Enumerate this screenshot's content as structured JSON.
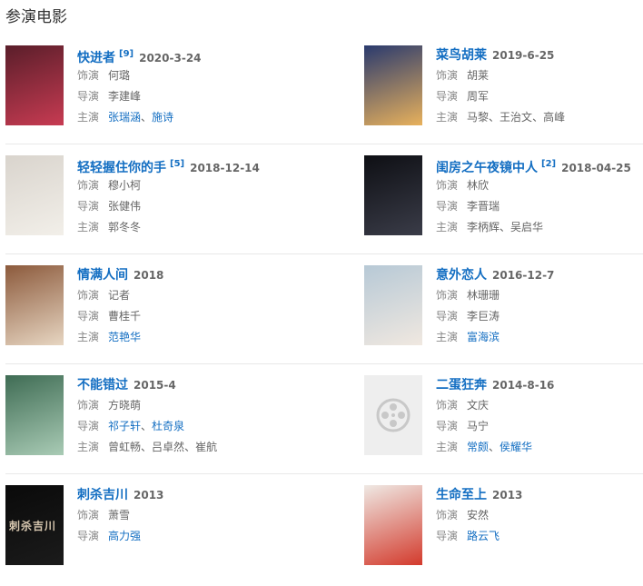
{
  "section_title": "参演电影",
  "labels": {
    "role": "饰演",
    "director": "导演",
    "cast": "主演"
  },
  "movies": [
    {
      "title": "快进者",
      "ref": "[9]",
      "date": "2020-3-24",
      "role": "何璐",
      "director": "李建峰",
      "cast": [
        "张瑞涵",
        "施诗"
      ],
      "cast_linked": true,
      "director_linked": false,
      "poster_colors": [
        "#5a1e2a",
        "#c73b52"
      ]
    },
    {
      "title": "菜鸟胡莱",
      "ref": "",
      "date": "2019-6-25",
      "role": "胡莱",
      "director": "周军",
      "cast": [
        "马黎",
        "王治文",
        "高峰"
      ],
      "cast_linked": false,
      "director_linked": false,
      "poster_colors": [
        "#2a3a6e",
        "#e8b15c"
      ]
    },
    {
      "title": "轻轻握住你的手",
      "ref": "[5]",
      "date": "2018-12-14",
      "role": "穆小柯",
      "director": "张健伟",
      "cast": [
        "郭冬冬"
      ],
      "cast_linked": false,
      "director_linked": false,
      "poster_colors": [
        "#d9d4cd",
        "#f2efe9"
      ]
    },
    {
      "title": "闺房之午夜镜中人",
      "ref": "[2]",
      "date": "2018-04-25",
      "role": "林欣",
      "director": "李晋瑞",
      "cast": [
        "李柄辉",
        "吴启华"
      ],
      "cast_linked": false,
      "director_linked": false,
      "poster_colors": [
        "#0e0f14",
        "#3a3c48"
      ]
    },
    {
      "title": "情满人间",
      "ref": "",
      "date": "2018",
      "role": "记者",
      "director": "曹桂千",
      "cast": [
        "范艳华"
      ],
      "cast_linked": true,
      "director_linked": false,
      "poster_colors": [
        "#8c5a3c",
        "#e7d6c2"
      ]
    },
    {
      "title": "意外恋人",
      "ref": "",
      "date": "2016-12-7",
      "role": "林珊珊",
      "director": "李巨涛",
      "cast": [
        "富海滨"
      ],
      "cast_linked": true,
      "director_linked": false,
      "poster_colors": [
        "#b7c9d6",
        "#f0e8e0"
      ]
    },
    {
      "title": "不能错过",
      "ref": "",
      "date": "2015-4",
      "role": "方晓萌",
      "director": "",
      "director_list": [
        "祁子轩",
        "杜奇泉"
      ],
      "cast": [
        "曾虹畅",
        "吕卓然",
        "崔航"
      ],
      "cast_linked": false,
      "director_linked": true,
      "poster_colors": [
        "#3f6c54",
        "#a9cbb5"
      ]
    },
    {
      "title": "二蛋狂奔",
      "ref": "",
      "date": "2014-8-16",
      "role": "文庆",
      "director": "马宁",
      "cast": [
        "常颇",
        "侯耀华"
      ],
      "cast_linked": true,
      "director_linked": false,
      "placeholder": true,
      "poster_colors": [
        "#eeeeee",
        "#eeeeee"
      ]
    },
    {
      "title": "刺杀吉川",
      "ref": "",
      "date": "2013",
      "role": "萧雪",
      "director": "高力强",
      "cast": [],
      "cast_linked": false,
      "director_linked": true,
      "poster_text": "刺杀吉川",
      "poster_colors": [
        "#0a0a0a",
        "#1b1b1b"
      ]
    },
    {
      "title": "生命至上",
      "ref": "",
      "date": "2013",
      "role": "安然",
      "director": "路云飞",
      "cast": [],
      "cast_linked": false,
      "director_linked": true,
      "poster_colors": [
        "#efe9e4",
        "#d33a2c"
      ]
    }
  ]
}
